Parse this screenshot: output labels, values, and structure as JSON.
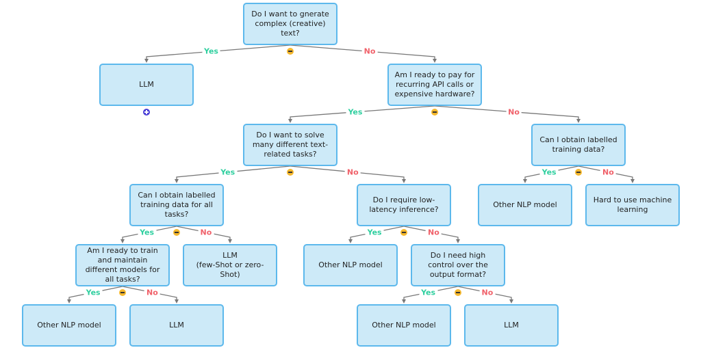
{
  "colors": {
    "node_fill": "#cdeaf8",
    "node_border": "#5cb8ec",
    "yes": "#2fcf9f",
    "no": "#f0616a",
    "collapse": "#f5b82e",
    "expand": "#4a3fd6",
    "edge": "#777777"
  },
  "nodes": [
    {
      "id": "n1",
      "text": "Do I want to gnerate complex (creative) text?"
    },
    {
      "id": "n2",
      "text": "LLM"
    },
    {
      "id": "n3",
      "text": "Am I ready to pay for recurring API calls or expensive hardware?"
    },
    {
      "id": "n4",
      "text": "Do I want to solve many different text-related tasks?"
    },
    {
      "id": "n5",
      "text": "Can I obtain labelled training data?"
    },
    {
      "id": "n6",
      "text": "Can I obtain labelled training data for all tasks?"
    },
    {
      "id": "n7",
      "text": "Do I require low-latency inference?"
    },
    {
      "id": "n8",
      "text": "Other NLP model"
    },
    {
      "id": "n9",
      "text": "Hard to use machine learning"
    },
    {
      "id": "n10",
      "text": "Am I ready to train and maintain different models for all tasks?"
    },
    {
      "id": "n11",
      "text": "LLM\n(few-Shot or zero-Shot)"
    },
    {
      "id": "n12",
      "text": "Other NLP model"
    },
    {
      "id": "n13",
      "text": "Do I need high control over the output format?"
    },
    {
      "id": "n14",
      "text": "Other NLP model"
    },
    {
      "id": "n15",
      "text": "LLM"
    },
    {
      "id": "n16",
      "text": "Other NLP model"
    },
    {
      "id": "n17",
      "text": "LLM"
    }
  ],
  "edges": [
    {
      "from": "n1",
      "to": "n2",
      "label": "Yes"
    },
    {
      "from": "n1",
      "to": "n3",
      "label": "No"
    },
    {
      "from": "n3",
      "to": "n4",
      "label": "Yes"
    },
    {
      "from": "n3",
      "to": "n5",
      "label": "No"
    },
    {
      "from": "n4",
      "to": "n6",
      "label": "Yes"
    },
    {
      "from": "n4",
      "to": "n7",
      "label": "No"
    },
    {
      "from": "n5",
      "to": "n8",
      "label": "Yes"
    },
    {
      "from": "n5",
      "to": "n9",
      "label": "No"
    },
    {
      "from": "n6",
      "to": "n10",
      "label": "Yes"
    },
    {
      "from": "n6",
      "to": "n11",
      "label": "No"
    },
    {
      "from": "n7",
      "to": "n12",
      "label": "Yes"
    },
    {
      "from": "n7",
      "to": "n13",
      "label": "No"
    },
    {
      "from": "n10",
      "to": "n14",
      "label": "Yes"
    },
    {
      "from": "n10",
      "to": "n15",
      "label": "No"
    },
    {
      "from": "n13",
      "to": "n16",
      "label": "Yes"
    },
    {
      "from": "n13",
      "to": "n17",
      "label": "No"
    }
  ],
  "collapsed_nodes": [
    "n2"
  ]
}
